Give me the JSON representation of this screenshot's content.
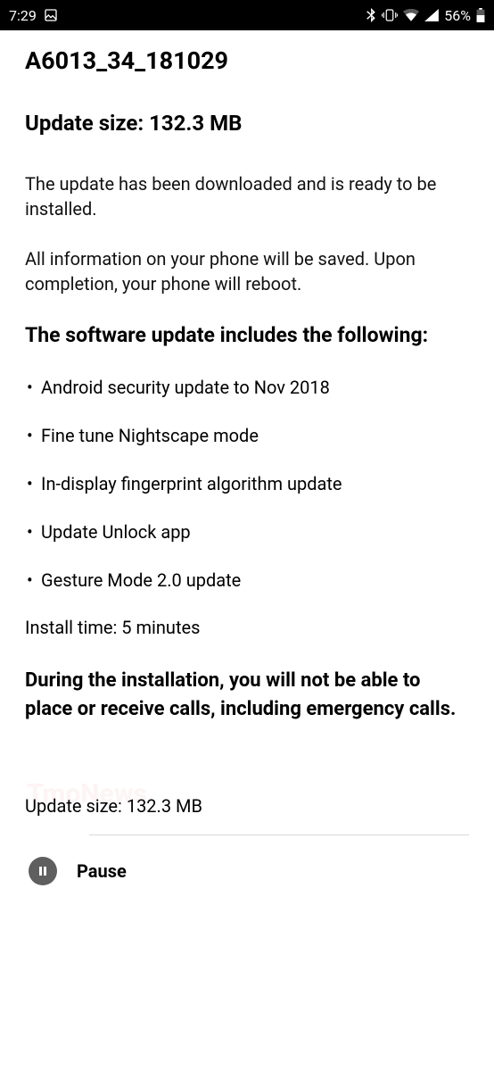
{
  "statusbar": {
    "time": "7:29",
    "battery_text": "56%"
  },
  "page": {
    "version": "A6013_34_181029",
    "size_heading": "Update size: 132.3 MB",
    "para1": "The update has been downloaded and is ready to be installed.",
    "para2": "All information on your phone will be saved. Upon completion, your phone will reboot.",
    "includes_heading": "The software update includes the following:",
    "bullets": [
      "Android security update to Nov 2018",
      "Fine tune Nightscape mode",
      "In-display fingerprint algorithm update",
      "Update Unlock app",
      "Gesture Mode 2.0 update"
    ],
    "install_time": "Install time: 5 minutes",
    "warning": "During the installation, you will not be able to place or receive calls, including emergency calls.",
    "footer_size": "Update size: 132.3 MB",
    "pause_label": "Pause"
  }
}
